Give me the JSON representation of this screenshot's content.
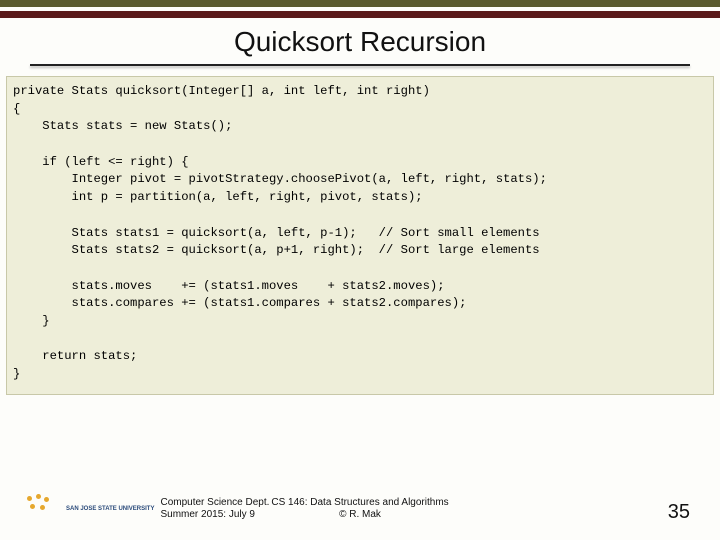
{
  "title": "Quicksort Recursion",
  "code": "private Stats quicksort(Integer[] a, int left, int right)\n{\n    Stats stats = new Stats();\n\n    if (left <= right) {\n        Integer pivot = pivotStrategy.choosePivot(a, left, right, stats);\n        int p = partition(a, left, right, pivot, stats);\n\n        Stats stats1 = quicksort(a, left, p-1);   // Sort small elements\n        Stats stats2 = quicksort(a, p+1, right);  // Sort large elements\n\n        stats.moves    += (stats1.moves    + stats2.moves);\n        stats.compares += (stats1.compares + stats2.compares);\n    }\n\n    return stats;\n}",
  "footer": {
    "dept_line1": "Computer Science Dept.",
    "dept_line2": "Summer 2015: July 9",
    "course_line1": "CS 146: Data Structures and Algorithms",
    "course_line2": "© R. Mak",
    "page_number": "35",
    "logo_text": "SAN JOSE STATE UNIVERSITY"
  }
}
